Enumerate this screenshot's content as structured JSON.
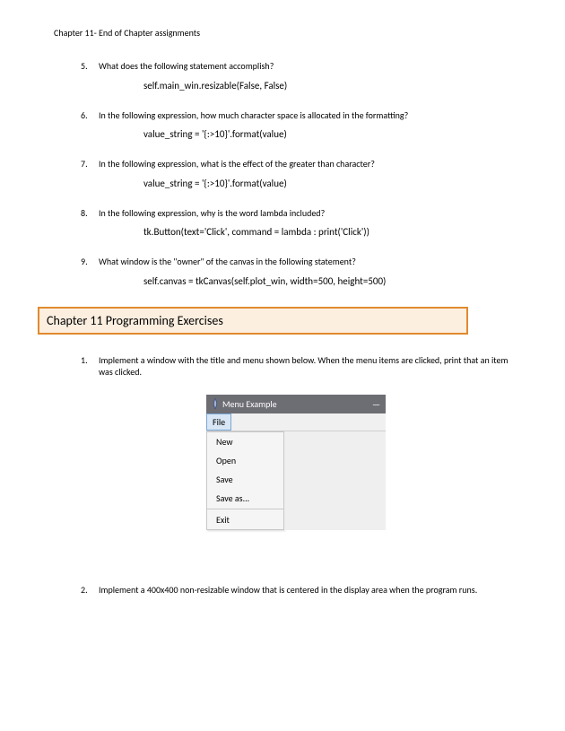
{
  "header": "Chapter 11- End of Chapter assignments",
  "questions": [
    {
      "num": "5.",
      "text": "What does the following statement accomplish?",
      "code": "self.main_win.resizable(False, False)"
    },
    {
      "num": "6.",
      "text": "In the following expression, how much character space is allocated in the formatting?",
      "code": "value_string = '{:>10}'.format(value)"
    },
    {
      "num": "7.",
      "text": "In the following expression, what is the  effect of the greater than character?",
      "code": "value_string = '{:>10}'.format(value)"
    },
    {
      "num": "8.",
      "text": "In the following expression, why is the word lambda included?",
      "code": "tk.Button(text='Click', command = lambda : print('Click'))"
    },
    {
      "num": "9.",
      "text": "What window is the \"owner\" of the canvas in the following statement?",
      "code": "self.canvas = tkCanvas(self.plot_win, width=500, height=500)"
    }
  ],
  "section_title": "Chapter 11 Programming Exercises",
  "programming": [
    {
      "num": "1.",
      "text": "Implement a window with the title and menu shown below.  When the menu items are clicked, print that an item was clicked."
    },
    {
      "num": "2.",
      "text": "Implement a 400x400 non-resizable window that is centered in the display area when the program runs."
    }
  ],
  "figure": {
    "title": "Menu Example",
    "minimize": "—",
    "menu_label": "File",
    "items": [
      "New",
      "Open",
      "Save",
      "Save as...",
      "Exit"
    ]
  }
}
